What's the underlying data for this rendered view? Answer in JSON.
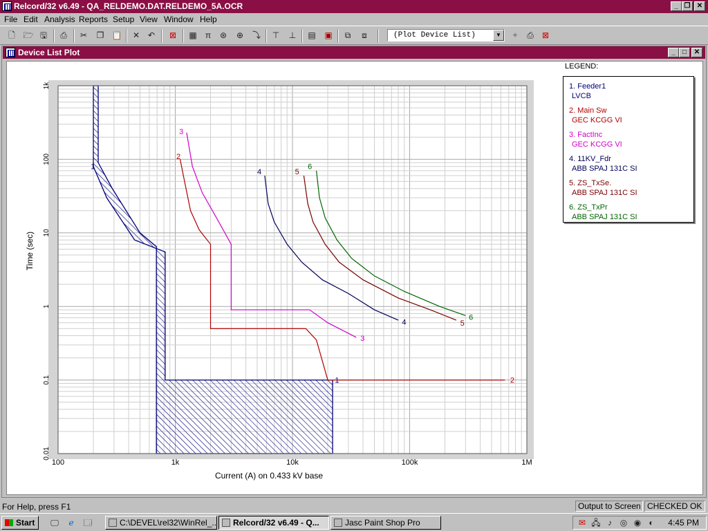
{
  "window": {
    "title": "Relcord/32 v6.49 - QA_RELDEMO.DAT.RELDEMO_5A.OCR",
    "min_glyph": "_",
    "max_glyph": "❐",
    "close_glyph": "✕"
  },
  "menu": [
    "File",
    "Edit",
    "Analysis",
    "Reports",
    "Setup",
    "View",
    "Window",
    "Help"
  ],
  "toolbar": {
    "combo_value": "(Plot Device List)",
    "combo_arrow": "▼"
  },
  "child": {
    "title": "Device List Plot",
    "min_glyph": "_",
    "max_glyph": "□",
    "close_glyph": "✕"
  },
  "legend": {
    "title": "LEGEND:",
    "entries": [
      {
        "name": "1. Feeder1",
        "device": "LVCB",
        "color": "#00007a"
      },
      {
        "name": "2. Main Sw",
        "device": "GEC KCGG VI",
        "color": "#b00000"
      },
      {
        "name": "3. FactInc",
        "device": "GEC KCGG VI",
        "color": "#d000c8"
      },
      {
        "name": "4. 11KV_Fdr",
        "device": "ABB SPAJ 131C SI",
        "color": "#00005a"
      },
      {
        "name": "5. ZS_TxSe.",
        "device": "ABB SPAJ 131C SI",
        "color": "#7a0000"
      },
      {
        "name": "6. ZS_TxPr",
        "device": "ABB SPAJ 131C SI",
        "color": "#006400"
      }
    ]
  },
  "chart_data": {
    "type": "line",
    "xscale": "log",
    "yscale": "log",
    "xlabel": "Current (A) on 0.433 kV base",
    "ylabel": "Time (sec)",
    "xlim": [
      100,
      1000000
    ],
    "ylim": [
      0.01,
      1000
    ],
    "xticks": [
      "100",
      "1k",
      "10k",
      "100k",
      "1M"
    ],
    "yticks": [
      "0.01",
      "0.1",
      "1",
      "10",
      "100",
      "1k"
    ],
    "grid": true,
    "series": [
      {
        "name": "1",
        "color": "#00007a",
        "band": true,
        "upper": [
          [
            220,
            1000
          ],
          [
            220,
            90
          ],
          [
            290,
            40
          ],
          [
            500,
            10
          ],
          [
            690,
            6.5
          ],
          [
            690,
            0.01
          ]
        ],
        "lower": [
          [
            200,
            1000
          ],
          [
            200,
            80
          ],
          [
            260,
            30
          ],
          [
            450,
            8
          ],
          [
            820,
            5.5
          ],
          [
            820,
            0.1
          ],
          [
            22000,
            0.1
          ],
          [
            22000,
            0.01
          ]
        ],
        "label_points": [
          [
            190,
            80
          ],
          [
            23000,
            0.1
          ]
        ]
      },
      {
        "name": "2",
        "color": "#b00000",
        "points": [
          [
            1100,
            100
          ],
          [
            1200,
            50
          ],
          [
            1350,
            20
          ],
          [
            1600,
            11
          ],
          [
            2000,
            7
          ],
          [
            2000,
            0.5
          ],
          [
            13000,
            0.5
          ],
          [
            16000,
            0.35
          ],
          [
            20000,
            0.1
          ],
          [
            650000,
            0.1
          ]
        ],
        "label_points": [
          [
            1020,
            110
          ],
          [
            720000,
            0.1
          ]
        ]
      },
      {
        "name": "3",
        "color": "#d000c8",
        "points": [
          [
            1250,
            230
          ],
          [
            1400,
            80
          ],
          [
            1700,
            35
          ],
          [
            2300,
            15
          ],
          [
            3000,
            7
          ],
          [
            3000,
            0.9
          ],
          [
            14000,
            0.9
          ],
          [
            20000,
            0.6
          ],
          [
            35000,
            0.38
          ]
        ],
        "label_points": [
          [
            1080,
            240
          ],
          [
            38000,
            0.37
          ]
        ]
      },
      {
        "name": "4",
        "color": "#00005a",
        "points": [
          [
            5800,
            60
          ],
          [
            6200,
            25
          ],
          [
            7000,
            14
          ],
          [
            9000,
            7
          ],
          [
            12000,
            4
          ],
          [
            18000,
            2.3
          ],
          [
            30000,
            1.5
          ],
          [
            50000,
            0.9
          ],
          [
            80000,
            0.65
          ]
        ],
        "label_points": [
          [
            5000,
            68
          ],
          [
            86000,
            0.62
          ]
        ]
      },
      {
        "name": "5",
        "color": "#7a0000",
        "points": [
          [
            12500,
            60
          ],
          [
            13500,
            25
          ],
          [
            15000,
            14
          ],
          [
            19000,
            7
          ],
          [
            25000,
            4
          ],
          [
            40000,
            2.3
          ],
          [
            80000,
            1.3
          ],
          [
            150000,
            0.9
          ],
          [
            250000,
            0.65
          ]
        ],
        "label_points": [
          [
            10500,
            68
          ],
          [
            270000,
            0.6
          ]
        ]
      },
      {
        "name": "6",
        "color": "#006400",
        "points": [
          [
            16000,
            70
          ],
          [
            17000,
            30
          ],
          [
            19000,
            16
          ],
          [
            24000,
            8
          ],
          [
            32000,
            4.5
          ],
          [
            50000,
            2.6
          ],
          [
            90000,
            1.6
          ],
          [
            180000,
            1.0
          ],
          [
            300000,
            0.75
          ]
        ],
        "label_points": [
          [
            13500,
            80
          ],
          [
            320000,
            0.72
          ]
        ]
      }
    ]
  },
  "status": {
    "help": "For Help, press F1",
    "output": "Output to Screen",
    "check": "CHECKED OK"
  },
  "taskbar": {
    "start": "Start",
    "tasks": [
      "C:\\DEVEL\\rel32\\WinRel_...",
      "Relcord/32 v6.49 - Q...",
      "Jasc Paint Shop Pro"
    ],
    "clock": "4:45 PM"
  }
}
